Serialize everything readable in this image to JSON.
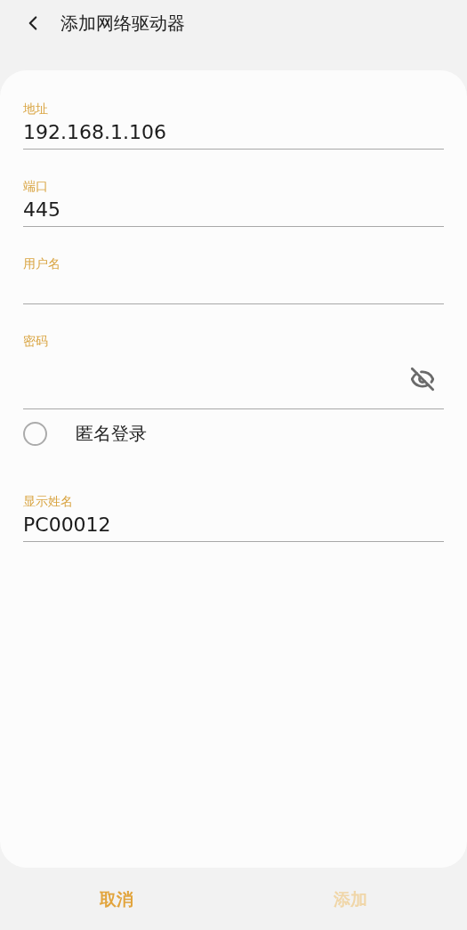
{
  "header": {
    "title": "添加网络驱动器"
  },
  "fields": [
    {
      "kind": "text",
      "label": "地址",
      "value": "192.168.1.106"
    },
    {
      "kind": "text",
      "label": "端口",
      "value": "445"
    },
    {
      "kind": "text",
      "label": "用户名"
    },
    {
      "kind": "password",
      "label": "密码"
    }
  ],
  "anonymous": {
    "label": "匿名登录",
    "checked": false
  },
  "display_name": {
    "label": "显示姓名",
    "value": "PC00012"
  },
  "buttons": [
    {
      "label": "取消",
      "disabled": false
    },
    {
      "label": "添加",
      "disabled": true
    }
  ]
}
